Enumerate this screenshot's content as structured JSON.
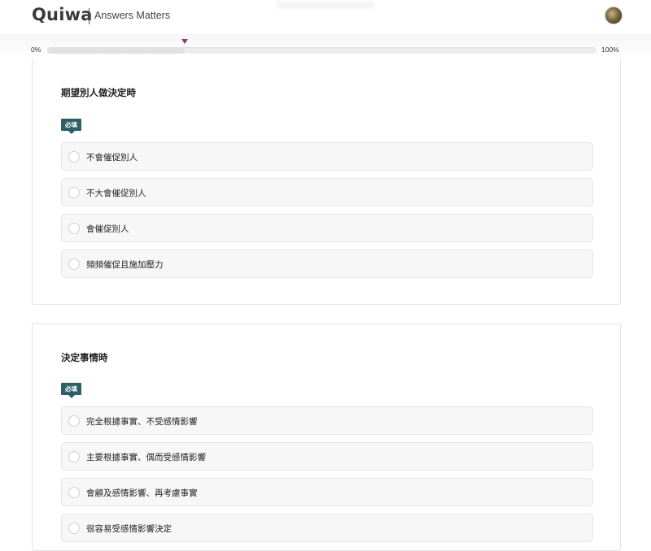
{
  "header": {
    "logo": "Quiwa",
    "tagline": "Answers Matters"
  },
  "progress": {
    "start_label": "0%",
    "end_label": "100%",
    "value": 0.25,
    "marker_color": "#8b3a6e"
  },
  "questions": [
    {
      "title": "期望別人做決定時",
      "required_label": "必填",
      "options": [
        "不會催促別人",
        "不大會催促別人",
        "會催促別人",
        "頻頻催促且施加壓力"
      ]
    },
    {
      "title": "決定事情時",
      "required_label": "必填",
      "options": [
        "完全根據事實、不受感情影響",
        "主要根據事實、偶而受感情影響",
        "會顧及感情影響、再考慮事實",
        "很容易受感情影響決定"
      ]
    }
  ],
  "colors": {
    "badge": "#2f5f66",
    "option_bg": "#f7f7f7"
  }
}
